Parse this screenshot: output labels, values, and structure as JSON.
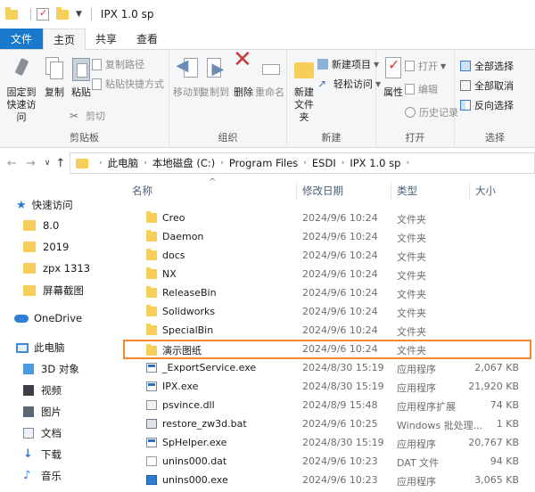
{
  "window": {
    "title": "IPX 1.0 sp"
  },
  "ribbon_tabs": [
    "文件",
    "主页",
    "共享",
    "查看"
  ],
  "ribbon": {
    "clipboard": {
      "label": "剪贴板",
      "pin": "固定到快速访问",
      "copy": "复制",
      "paste": "粘贴",
      "copy_path": "复制路径",
      "paste_shortcut": "粘贴快捷方式",
      "cut": "剪切"
    },
    "organize": {
      "label": "组织",
      "move_to": "移动到",
      "copy_to": "复制到",
      "delete": "删除",
      "rename": "重命名"
    },
    "new": {
      "label": "新建",
      "new_folder": "新建文件夹",
      "new_item": "新建项目",
      "easy_access": "轻松访问"
    },
    "open": {
      "label": "打开",
      "properties": "属性",
      "open": "打开",
      "edit": "编辑",
      "history": "历史记录"
    },
    "select": {
      "label": "选择",
      "select_all": "全部选择",
      "select_none": "全部取消",
      "invert": "反向选择"
    }
  },
  "address": {
    "crumbs": [
      "此电脑",
      "本地磁盘 (C:)",
      "Program Files",
      "ESDI",
      "IPX 1.0 sp"
    ]
  },
  "nav_pane": {
    "quick_access": "快速访问",
    "quick_items": [
      "8.0",
      "2019",
      "zpx 1313",
      "屏幕截图"
    ],
    "onedrive": "OneDrive",
    "this_pc": "此电脑",
    "pc_items": [
      "3D 对象",
      "视频",
      "图片",
      "文档",
      "下载",
      "音乐"
    ]
  },
  "columns": {
    "name": "名称",
    "date": "修改日期",
    "type": "类型",
    "size": "大小"
  },
  "files": [
    {
      "name": "Creo",
      "date": "2024/9/6 10:24",
      "type": "文件夹",
      "size": "",
      "icon": "folder"
    },
    {
      "name": "Daemon",
      "date": "2024/9/6 10:24",
      "type": "文件夹",
      "size": "",
      "icon": "folder"
    },
    {
      "name": "docs",
      "date": "2024/9/6 10:24",
      "type": "文件夹",
      "size": "",
      "icon": "folder"
    },
    {
      "name": "NX",
      "date": "2024/9/6 10:24",
      "type": "文件夹",
      "size": "",
      "icon": "folder"
    },
    {
      "name": "ReleaseBin",
      "date": "2024/9/6 10:24",
      "type": "文件夹",
      "size": "",
      "icon": "folder"
    },
    {
      "name": "Solidworks",
      "date": "2024/9/6 10:24",
      "type": "文件夹",
      "size": "",
      "icon": "folder"
    },
    {
      "name": "SpecialBin",
      "date": "2024/9/6 10:24",
      "type": "文件夹",
      "size": "",
      "icon": "folder"
    },
    {
      "name": "演示图纸",
      "date": "2024/9/6 10:24",
      "type": "文件夹",
      "size": "",
      "icon": "folder"
    },
    {
      "name": "_ExportService.exe",
      "date": "2024/8/30 15:19",
      "type": "应用程序",
      "size": "2,067 KB",
      "icon": "exe"
    },
    {
      "name": "IPX.exe",
      "date": "2024/8/30 15:19",
      "type": "应用程序",
      "size": "21,920 KB",
      "icon": "exe"
    },
    {
      "name": "psvince.dll",
      "date": "2024/8/9 15:48",
      "type": "应用程序扩展",
      "size": "74 KB",
      "icon": "dll"
    },
    {
      "name": "restore_zw3d.bat",
      "date": "2024/9/6 10:25",
      "type": "Windows 批处理...",
      "size": "1 KB",
      "icon": "bat"
    },
    {
      "name": "SpHelper.exe",
      "date": "2024/8/30 15:19",
      "type": "应用程序",
      "size": "20,767 KB",
      "icon": "exe"
    },
    {
      "name": "unins000.dat",
      "date": "2024/9/6 10:23",
      "type": "DAT 文件",
      "size": "94 KB",
      "icon": "dat"
    },
    {
      "name": "unins000.exe",
      "date": "2024/9/6 10:23",
      "type": "应用程序",
      "size": "3,065 KB",
      "icon": "blue"
    }
  ],
  "highlight_color": "#f08a2c",
  "accent_color": "#1979ca"
}
